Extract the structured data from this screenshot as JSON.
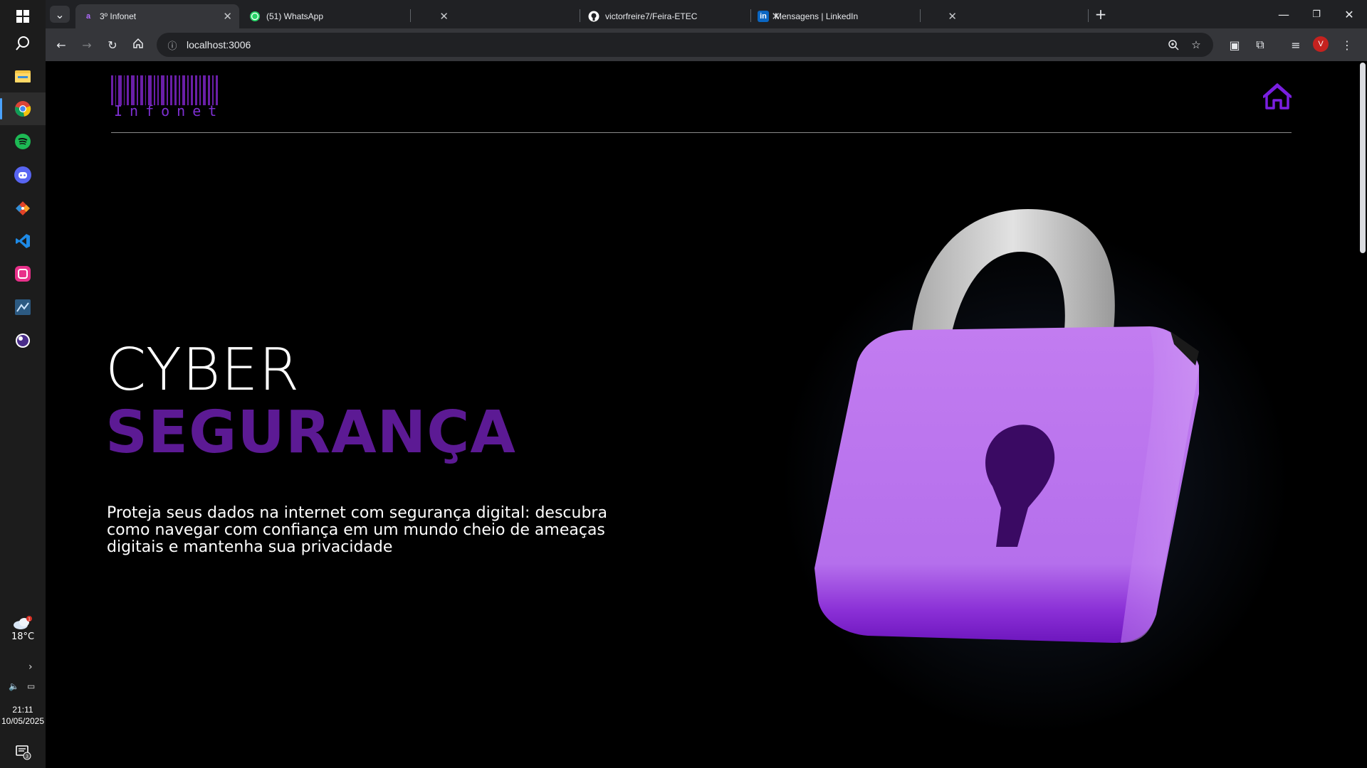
{
  "taskbar": {
    "icons": [
      "windows-start-icon",
      "search-icon",
      "file-explorer-icon",
      "chrome-icon",
      "spotify-icon",
      "discord-icon",
      "git-icon",
      "vscode-icon",
      "wamp-icon",
      "mysql-workbench-icon",
      "obs-icon"
    ],
    "weather": {
      "temp": "18°C",
      "badge": "1"
    },
    "clock": {
      "time": "21:11",
      "date": "10/05/2025"
    },
    "notifications_badge": "3"
  },
  "browser": {
    "tabs": [
      {
        "title": "3º Infonet",
        "favicon": "infonet-favicon",
        "active": true
      },
      {
        "title": "(51) WhatsApp",
        "favicon": "whatsapp-icon",
        "active": false
      },
      {
        "title": "victorfreire7/Feira-ETEC",
        "favicon": "github-icon",
        "active": false
      },
      {
        "title": "Mensagens | LinkedIn",
        "favicon": "linkedin-icon",
        "active": false
      }
    ],
    "url": "localhost:3006",
    "profile_initial": "V"
  },
  "page": {
    "logo_text": "Infonet",
    "hero": {
      "title_line1": "CYBER",
      "title_line2": "SEGURANÇA",
      "description": "Proteja seus dados na internet com segurança digital: descubra como navegar com confiança em um mundo cheio de ameaças digitais e mantenha sua privacidade"
    },
    "colors": {
      "accent": "#5c1a94",
      "logo": "#6a1fa8",
      "home_icon": "#7a1fe0",
      "padlock_body": "#b872ee",
      "padlock_shackle": "#c8c8c8",
      "keyhole": "#3a0a63"
    }
  }
}
